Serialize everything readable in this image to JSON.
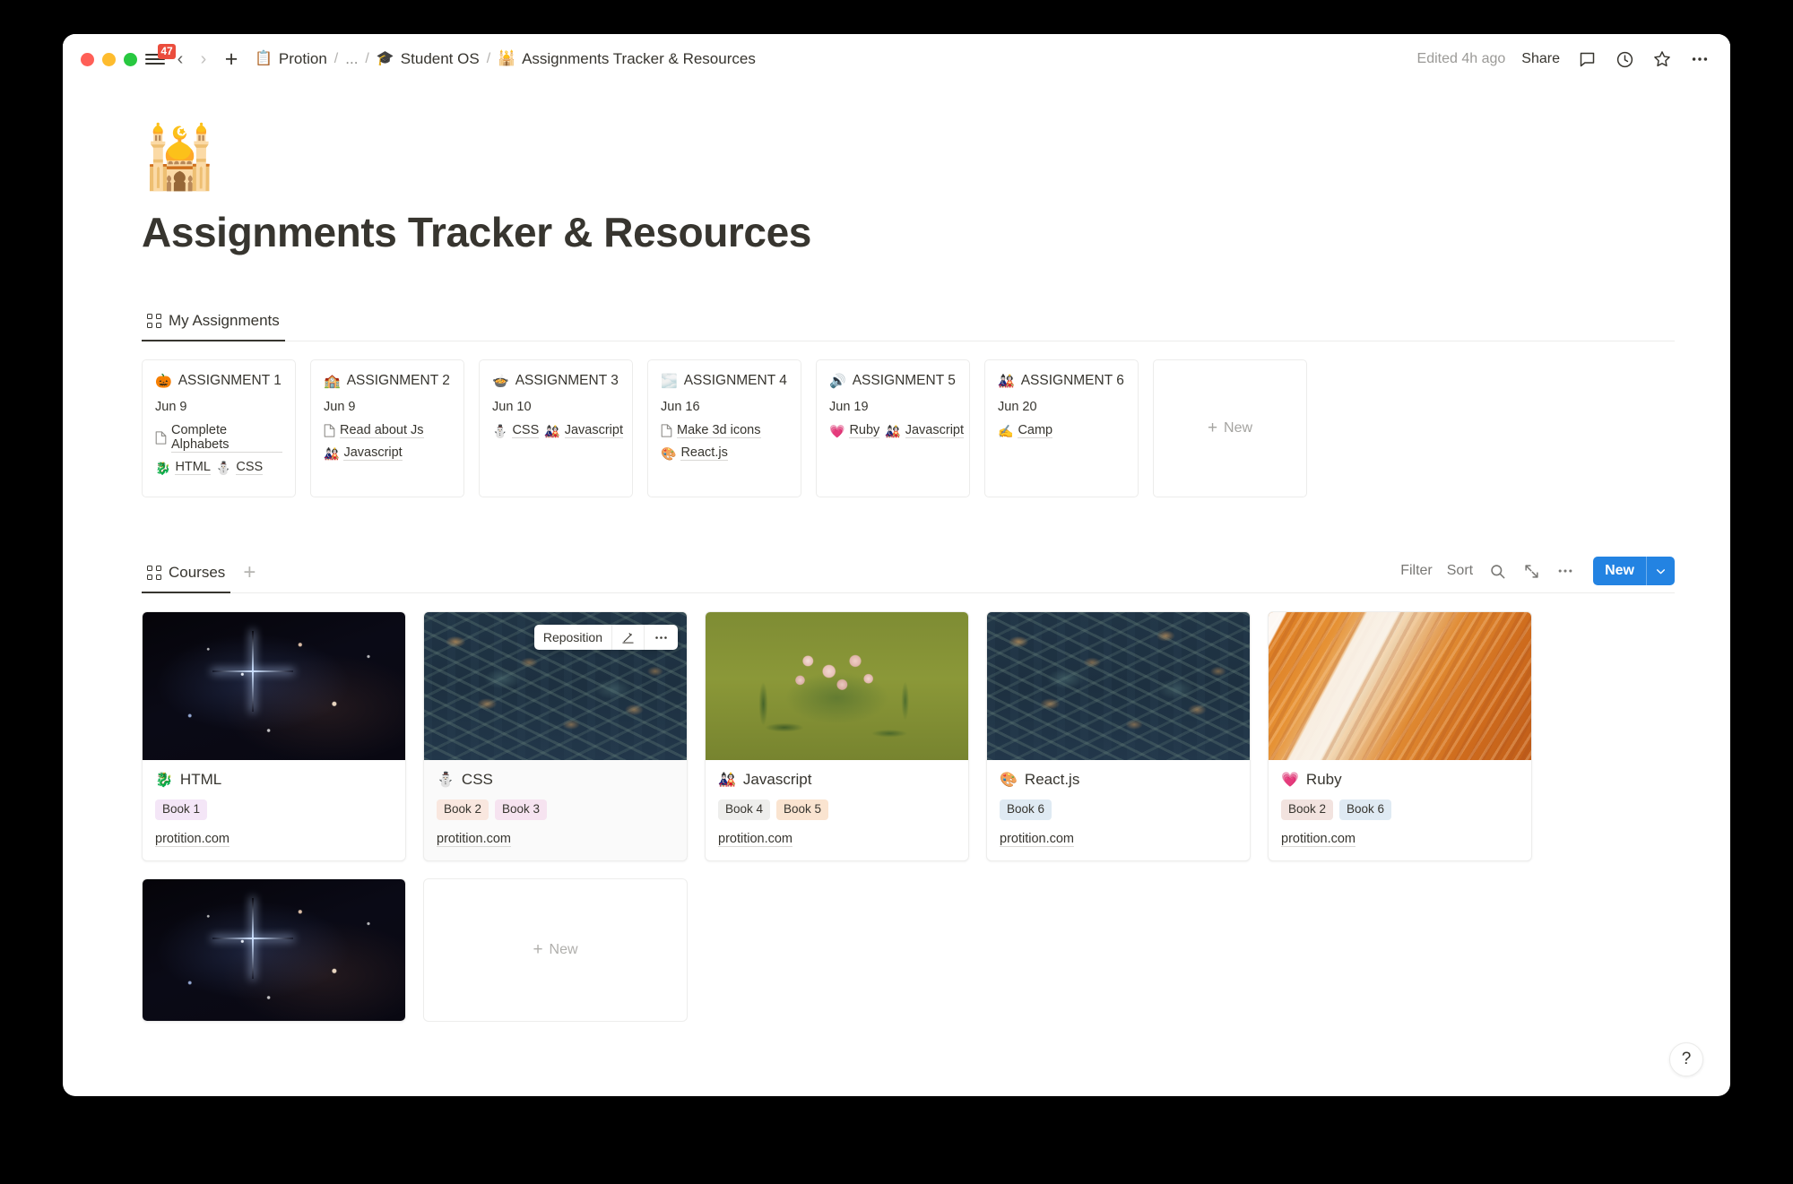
{
  "titlebar": {
    "notification_count": "47",
    "breadcrumbs": [
      {
        "emoji": "📋",
        "label": "Protion",
        "icon_name": "clipboard-icon"
      },
      {
        "emoji": "",
        "label": "...",
        "icon_name": ""
      },
      {
        "emoji": "🎓",
        "label": "Student OS",
        "icon_name": "graduation-icon"
      },
      {
        "emoji": "🕌",
        "label": "Assignments Tracker & Resources",
        "icon_name": "mosque-icon"
      }
    ],
    "separator": "/",
    "edited_label": "Edited 4h ago",
    "share_label": "Share",
    "icons": [
      "comment-icon",
      "history-icon",
      "star-icon",
      "more-icon"
    ]
  },
  "page": {
    "emoji": "🕌",
    "title": "Assignments Tracker & Resources"
  },
  "assignments_db": {
    "tab_label": "My Assignments",
    "new_card_label": "New",
    "cards": [
      {
        "emoji": "🎃",
        "title": "ASSIGNMENT 1",
        "date": "Jun 9",
        "task": "Complete Alphabets",
        "tags": [
          {
            "emoji": "🐉",
            "label": "HTML"
          },
          {
            "emoji": "⛄",
            "label": "CSS"
          }
        ]
      },
      {
        "emoji": "🏫",
        "title": "ASSIGNMENT 2",
        "date": "Jun 9",
        "task": "Read about Js",
        "tags": [
          {
            "emoji": "🎎",
            "label": "Javascript"
          }
        ]
      },
      {
        "emoji": "🍲",
        "title": "ASSIGNMENT 3",
        "date": "Jun 10",
        "task": "",
        "tags": [
          {
            "emoji": "⛄",
            "label": "CSS"
          },
          {
            "emoji": "🎎",
            "label": "Javascript"
          }
        ]
      },
      {
        "emoji": "🌫️",
        "title": "ASSIGNMENT 4",
        "date": "Jun 16",
        "task": "Make 3d icons",
        "tags": [
          {
            "emoji": "🎨",
            "label": "React.js"
          }
        ]
      },
      {
        "emoji": "🔊",
        "title": "ASSIGNMENT 5",
        "date": "Jun 19",
        "task": "",
        "tags": [
          {
            "emoji": "💗",
            "label": "Ruby"
          },
          {
            "emoji": "🎎",
            "label": "Javascript"
          }
        ]
      },
      {
        "emoji": "🎎",
        "title": "ASSIGNMENT 6",
        "date": "Jun 20",
        "task": "",
        "tags": [
          {
            "emoji": "✍️",
            "label": "Camp"
          }
        ]
      }
    ]
  },
  "courses_db": {
    "tab_label": "Courses",
    "add_view_label": "+",
    "toolbar": {
      "filter_label": "Filter",
      "sort_label": "Sort",
      "search_icon": "search-icon",
      "expand_icon": "expand-icon",
      "more_icon": "more-icon",
      "new_label": "New",
      "new_chevron_icon": "chevron-down-icon"
    },
    "reposition_overlay": {
      "label": "Reposition",
      "edit_icon": "pencil-icon",
      "more_icon": "more-icon"
    },
    "new_card_label": "New",
    "cards": [
      {
        "cover": "space",
        "emoji": "🐉",
        "title": "HTML",
        "tags": [
          {
            "label": "Book 1",
            "bg": "#f4e6f7",
            "fg": "#3f3f3f"
          }
        ],
        "url": "protition.com",
        "selected": false
      },
      {
        "cover": "morris",
        "emoji": "⛄",
        "title": "CSS",
        "tags": [
          {
            "label": "Book 2",
            "bg": "#f9e7df",
            "fg": "#3f3f3f"
          },
          {
            "label": "Book 3",
            "bg": "#f6e3f0",
            "fg": "#3f3f3f"
          }
        ],
        "url": "protition.com",
        "selected": true
      },
      {
        "cover": "flowers",
        "emoji": "🎎",
        "title": "Javascript",
        "tags": [
          {
            "label": "Book 4",
            "bg": "#eeeeec",
            "fg": "#3f3f3f"
          },
          {
            "label": "Book 5",
            "bg": "#fae4d0",
            "fg": "#3f3f3f"
          }
        ],
        "url": "protition.com",
        "selected": false
      },
      {
        "cover": "morris",
        "emoji": "🎨",
        "title": "React.js",
        "tags": [
          {
            "label": "Book 6",
            "bg": "#dfeaf3",
            "fg": "#3f3f3f"
          }
        ],
        "url": "protition.com",
        "selected": false
      },
      {
        "cover": "canyon",
        "emoji": "💗",
        "title": "Ruby",
        "tags": [
          {
            "label": "Book 2",
            "bg": "#f2e3df",
            "fg": "#3f3f3f"
          },
          {
            "label": "Book 6",
            "bg": "#dfeaf3",
            "fg": "#3f3f3f"
          }
        ],
        "url": "protition.com",
        "selected": false
      },
      {
        "cover": "space",
        "emoji": "",
        "title": "",
        "tags": [],
        "url": "",
        "selected": false
      }
    ]
  },
  "help_button": {
    "label": "?"
  },
  "colors": {
    "accent_blue": "#2383e2",
    "text": "#37352f",
    "muted": "#9b9a97",
    "border": "#ebebea",
    "badge_red": "#eb4d3d"
  }
}
